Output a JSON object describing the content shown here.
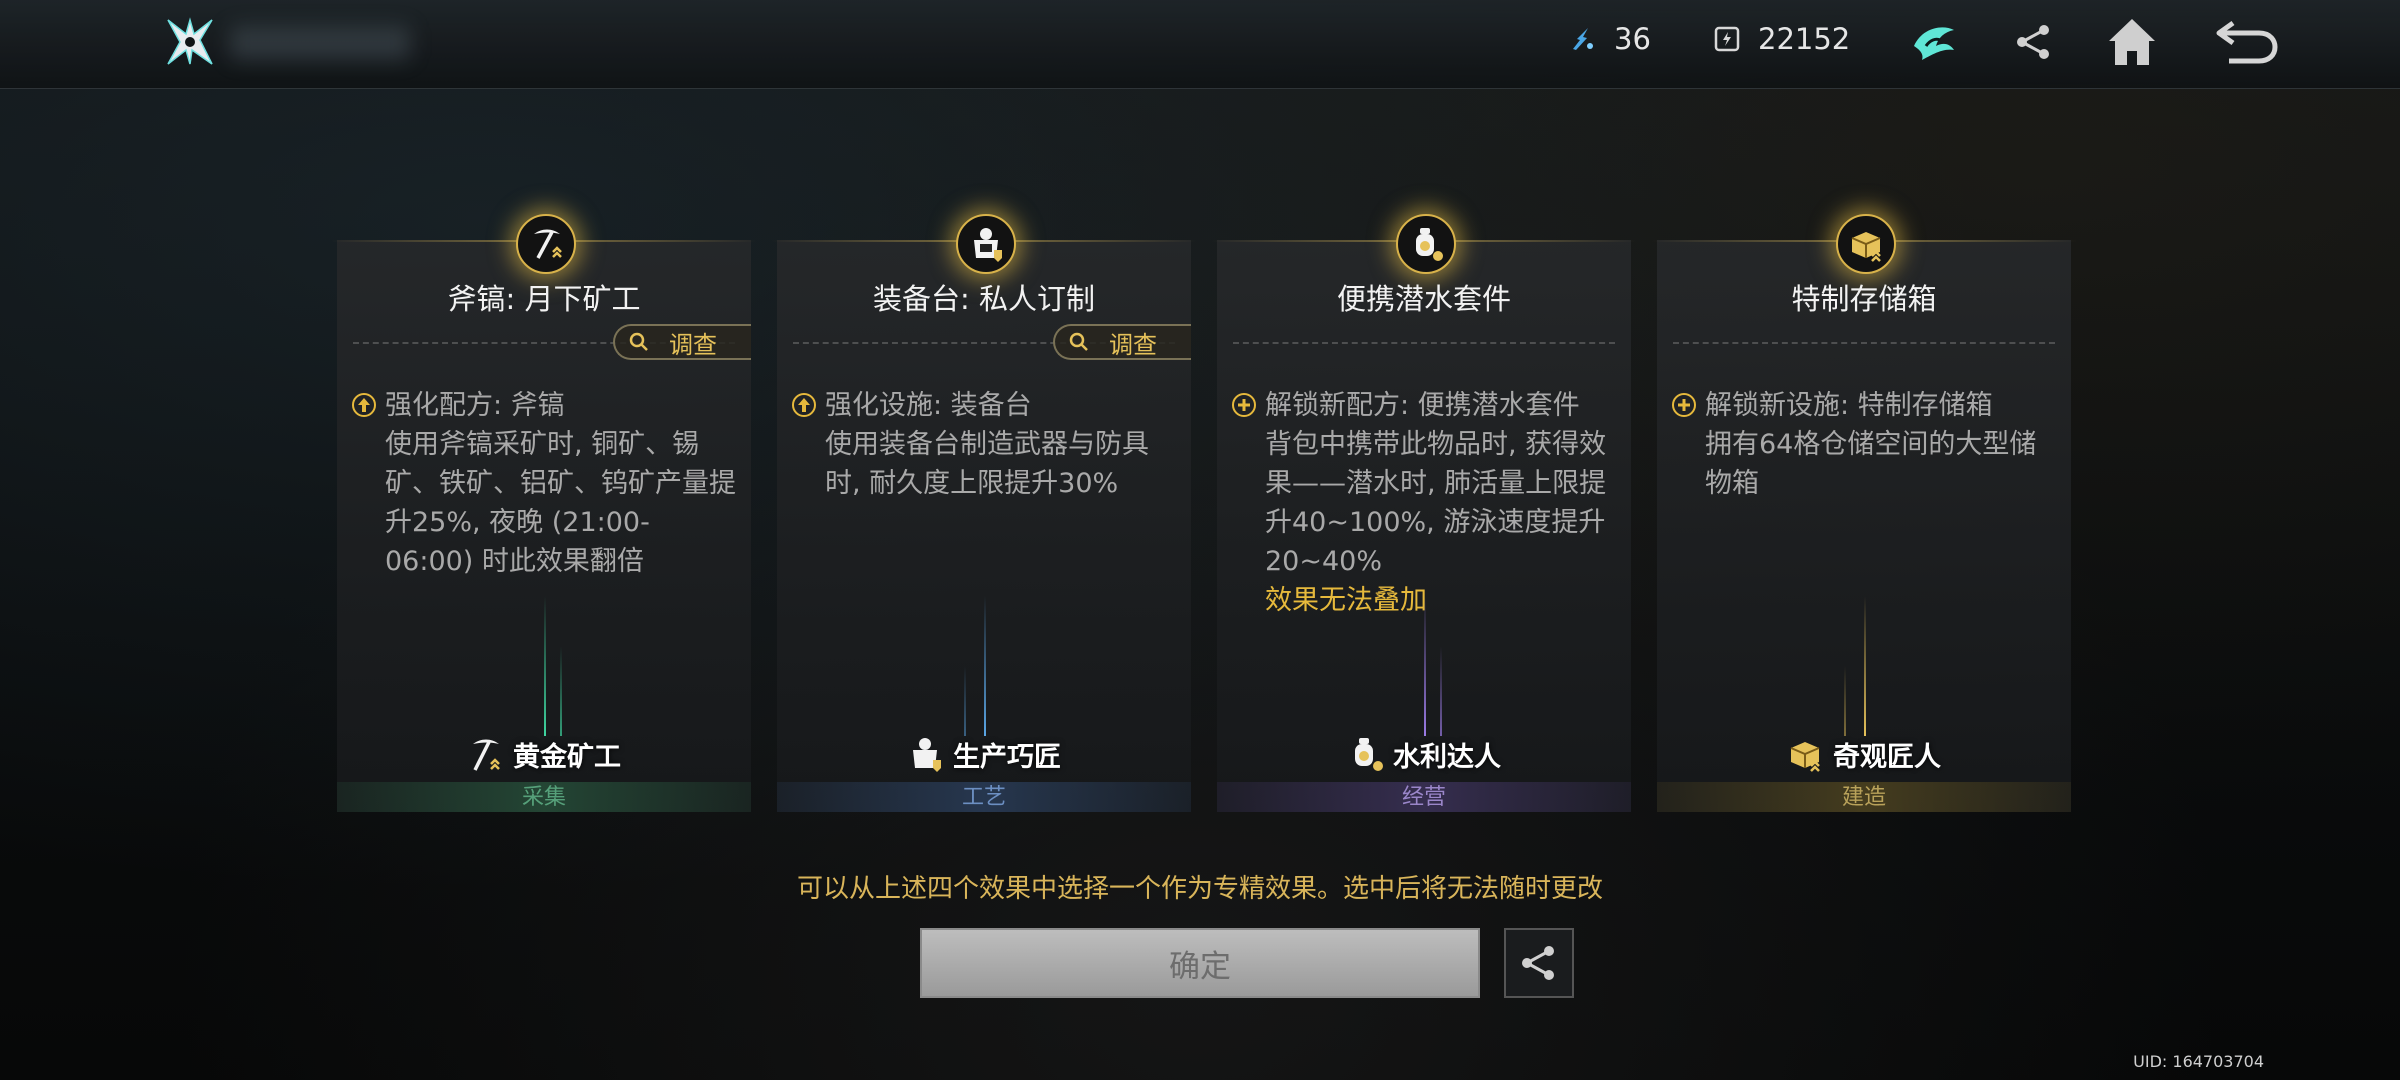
{
  "topbar": {
    "currency1_value": "36",
    "currency2_value": "22152"
  },
  "cards": [
    {
      "title": "斧镐: 月下矿工",
      "investigate_label": "调查",
      "effect_type": "强化配方: 斧镐",
      "description": "使用斧镐采矿时, 铜矿、锡矿、铁矿、铝矿、钨矿产量提升25%, 夜晚 (21:00-06:00) 时此效果翻倍",
      "warning": "",
      "role_name": "黄金矿工",
      "category": "采集",
      "accent": "#2f6b4a"
    },
    {
      "title": "装备台: 私人订制",
      "investigate_label": "调查",
      "effect_type": "强化设施: 装备台",
      "description": "使用装备台制造武器与防具时, 耐久度上限提升30%",
      "warning": "",
      "role_name": "生产巧匠",
      "category": "工艺",
      "accent": "#34507a"
    },
    {
      "title": "便携潜水套件",
      "investigate_label": "",
      "effect_type": "解锁新配方: 便携潜水套件",
      "description": "背包中携带此物品时, 获得效果——潜水时, 肺活量上限提升40~100%, 游泳速度提升20~40%",
      "warning": "效果无法叠加",
      "role_name": "水利达人",
      "category": "经营",
      "accent": "#4f3f7a"
    },
    {
      "title": "特制存储箱",
      "investigate_label": "",
      "effect_type": "解锁新设施: 特制存储箱",
      "description": "拥有64格仓储空间的大型储物箱",
      "warning": "",
      "role_name": "奇观匠人",
      "category": "建造",
      "accent": "#6b5a22"
    }
  ],
  "hint_text": "可以从上述四个效果中选择一个作为专精效果。选中后将无法随时更改",
  "confirm_label": "确定",
  "uid_text": "UID: 164703704",
  "colors": {
    "gold": "#e6c25a",
    "beam_green": "#3fd6a0",
    "beam_blue": "#5aa6e6",
    "beam_purple": "#9b7be6",
    "beam_gold": "#e6c25a"
  }
}
